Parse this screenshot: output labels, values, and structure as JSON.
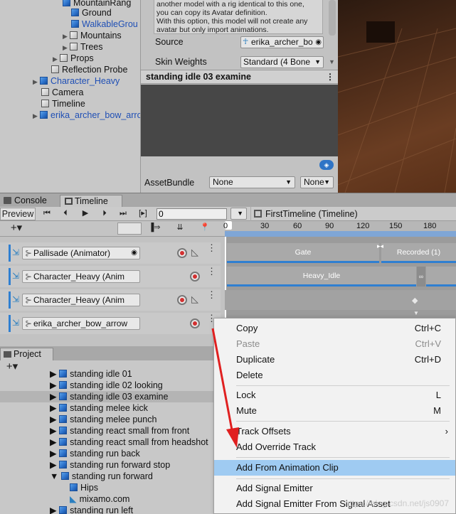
{
  "hierarchy": {
    "items": [
      {
        "label": "MountainRang",
        "blue": false
      },
      {
        "label": "Ground",
        "blue": false
      },
      {
        "label": "WalkableGrou",
        "blue": true
      },
      {
        "label": "Mountains",
        "blue": false
      },
      {
        "label": "Trees",
        "blue": false
      },
      {
        "label": "Props",
        "blue": false
      },
      {
        "label": "Reflection Probe",
        "blue": false
      },
      {
        "label": "Character_Heavy",
        "blue": true
      },
      {
        "label": "Camera",
        "blue": false
      },
      {
        "label": "Timeline",
        "blue": false
      },
      {
        "label": "erika_archer_bow_arro",
        "blue": true
      }
    ]
  },
  "inspector": {
    "help_lines": [
      "another model with a rig identical to this one,",
      "you can copy its Avatar definition.",
      "With this option, this model will not create any",
      "avatar but only import animations."
    ],
    "source_label": "Source",
    "source_value": "erika_archer_bo",
    "skin_weights_label": "Skin Weights",
    "skin_weights_value": "Standard (4 Bone",
    "preview_title": "standing idle 03 examine",
    "assetbundle_label": "AssetBundle",
    "assetbundle_value": "None",
    "assetbundle_variant": "None"
  },
  "tabs": {
    "console": "Console",
    "timeline": "Timeline"
  },
  "timeline": {
    "preview_label": "Preview",
    "frame_value": "0",
    "breadcrumb": "FirstTimeline (Timeline)",
    "ruler_ticks": [
      "0",
      "30",
      "60",
      "90",
      "120",
      "150",
      "180"
    ],
    "tracks": [
      {
        "name": "Pallisade (Animator)",
        "has_curve": true
      },
      {
        "name": "Character_Heavy (Anim",
        "has_curve": false
      },
      {
        "name": "Character_Heavy (Anim",
        "has_curve": true
      },
      {
        "name": "erika_archer_bow_arrow",
        "has_curve": false
      }
    ],
    "clips": {
      "gate": "Gate",
      "recorded": "Recorded (1)",
      "heavy_idle": "Heavy_Idle"
    }
  },
  "project": {
    "tab_label": "Project",
    "items": [
      {
        "label": "standing idle 01",
        "depth": 0
      },
      {
        "label": "standing idle 02 looking",
        "depth": 0
      },
      {
        "label": "standing idle 03 examine",
        "depth": 0,
        "selected": true
      },
      {
        "label": "standing melee kick",
        "depth": 0
      },
      {
        "label": "standing melee punch",
        "depth": 0
      },
      {
        "label": "standing react small from front",
        "depth": 0
      },
      {
        "label": "standing react small from headshot",
        "depth": 0
      },
      {
        "label": "standing run back",
        "depth": 0
      },
      {
        "label": "standing run forward stop",
        "depth": 0
      },
      {
        "label": "standing run forward",
        "depth": 0,
        "expanded": true
      },
      {
        "label": "Hips",
        "depth": 1
      },
      {
        "label": "mixamo.com",
        "depth": 1
      },
      {
        "label": "standing run left",
        "depth": 0
      }
    ]
  },
  "context_menu": {
    "copy": "Copy",
    "copy_sc": "Ctrl+C",
    "paste": "Paste",
    "paste_sc": "Ctrl+V",
    "duplicate": "Duplicate",
    "duplicate_sc": "Ctrl+D",
    "delete": "Delete",
    "lock": "Lock",
    "lock_sc": "L",
    "mute": "Mute",
    "mute_sc": "M",
    "track_offsets": "Track Offsets",
    "add_override": "Add Override Track",
    "add_from_clip": "Add From Animation Clip",
    "add_signal": "Add Signal Emitter",
    "add_signal_asset": "Add Signal Emitter From Signal Asset"
  },
  "watermark": "https://blog.csdn.net/js0907",
  "colors": {
    "accent_blue": "#2f7fd1",
    "menu_highlight": "#9fcbf2",
    "arrow_red": "#e02020"
  }
}
